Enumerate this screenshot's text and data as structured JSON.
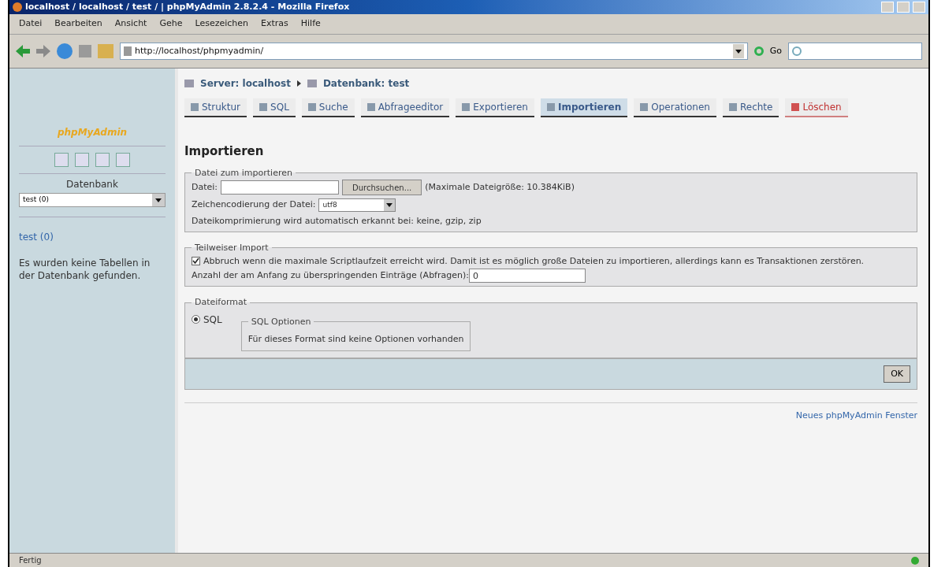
{
  "window": {
    "title": "localhost / localhost / test / | phpMyAdmin 2.8.2.4 - Mozilla Firefox"
  },
  "menu": [
    "Datei",
    "Bearbeiten",
    "Ansicht",
    "Gehe",
    "Lesezeichen",
    "Extras",
    "Hilfe"
  ],
  "address_bar": {
    "url": "http://localhost/phpmyadmin/",
    "go_label": "Go"
  },
  "sidebar": {
    "logo": "phpMyAdmin",
    "database_label": "Datenbank",
    "database_select": "test (0)",
    "database_link": "test (0)",
    "message": "Es wurden keine Tabellen in der Datenbank gefunden."
  },
  "breadcrumb": [
    "Server: localhost",
    "Datenbank: test"
  ],
  "tabs": [
    {
      "label": "Struktur",
      "selected": false,
      "danger": false
    },
    {
      "label": "SQL",
      "selected": false,
      "danger": false
    },
    {
      "label": "Suche",
      "selected": false,
      "danger": false
    },
    {
      "label": "Abfrageeditor",
      "selected": false,
      "danger": false
    },
    {
      "label": "Exportieren",
      "selected": false,
      "danger": false
    },
    {
      "label": "Importieren",
      "selected": true,
      "danger": false
    },
    {
      "label": "Operationen",
      "selected": false,
      "danger": false
    },
    {
      "label": "Rechte",
      "selected": false,
      "danger": false
    },
    {
      "label": "Löschen",
      "selected": false,
      "danger": true
    }
  ],
  "heading": "Importieren",
  "file_section": {
    "legend": "Datei zum importieren",
    "file_label": "Datei:",
    "browse_button": "Durchsuchen...",
    "max_size": "(Maximale Dateigröße: 10.384KiB)",
    "charset_label": "Zeichencodierung der Datei:",
    "charset_value": "utf8",
    "compression_note": "Dateikomprimierung wird automatisch erkannt bei: keine, gzip, zip"
  },
  "partial_section": {
    "legend": "Teilweiser Import",
    "interrupt_checkbox": {
      "label": "Abbruch wenn die maximale Scriptlaufzeit erreicht wird. Damit ist es möglich große Dateien zu importieren, allerdings kann es Transaktionen zerstören.",
      "checked": true
    },
    "skip_label": "Anzahl der am Anfang zu überspringenden Einträge (Abfragen):",
    "skip_value": "0"
  },
  "format_section": {
    "legend": "Dateiformat",
    "formats": [
      {
        "label": "SQL",
        "selected": true
      }
    ],
    "options_legend": "SQL Optionen",
    "options_note": "Für dieses Format sind keine Optionen vorhanden"
  },
  "submit_button": "OK",
  "footer_link": "Neues phpMyAdmin Fenster",
  "status_bar": "Fertig"
}
